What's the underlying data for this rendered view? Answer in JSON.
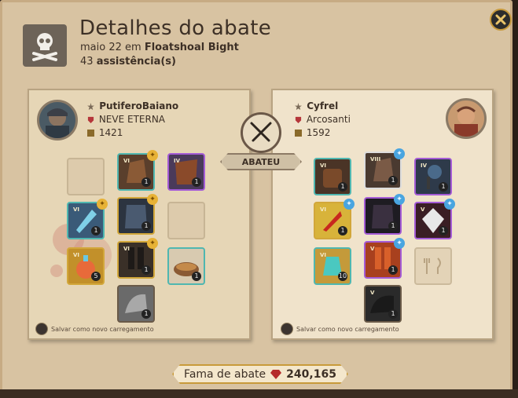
{
  "header": {
    "title": "Detalhes do abate",
    "date": "maio 22 em",
    "location": "Floatshoal Bight",
    "assist_count": "43",
    "assist_label": "assistência(s)"
  },
  "killer": {
    "name": "PutiferoBaiano",
    "guild": "NEVE ETERNA",
    "ip": "1421",
    "save_label": "Salvar como novo carregamento",
    "slots": [
      {
        "name": "bag-slot",
        "qty": "",
        "tier": "",
        "empty": true
      },
      {
        "name": "head-slot",
        "qty": "1",
        "tier": "VI",
        "empty": false
      },
      {
        "name": "cape-slot",
        "qty": "1",
        "tier": "IV",
        "empty": false
      },
      {
        "name": "mainhand-slot",
        "qty": "1",
        "tier": "VI",
        "empty": false
      },
      {
        "name": "armor-slot",
        "qty": "1",
        "tier": "",
        "empty": false
      },
      {
        "name": "offhand-slot",
        "qty": "",
        "tier": "",
        "empty": true
      },
      {
        "name": "potion-slot",
        "qty": "5",
        "tier": "VI",
        "empty": false
      },
      {
        "name": "shoes-slot",
        "qty": "1",
        "tier": "VI",
        "empty": false
      },
      {
        "name": "food-slot",
        "qty": "1",
        "tier": "",
        "empty": false
      },
      {
        "name": "mount-slot",
        "qty": "1",
        "tier": "",
        "empty": false
      }
    ]
  },
  "victim": {
    "name": "Cyfrel",
    "guild": "Arcosanti",
    "ip": "1592",
    "save_label": "Salvar como novo carregamento",
    "slots": [
      {
        "name": "bag-slot",
        "qty": "1",
        "tier": "VI",
        "empty": false
      },
      {
        "name": "head-slot",
        "qty": "1",
        "tier": "VIII",
        "empty": false
      },
      {
        "name": "cape-slot",
        "qty": "1",
        "tier": "IV",
        "empty": false
      },
      {
        "name": "mainhand-slot",
        "qty": "1",
        "tier": "VI",
        "empty": false
      },
      {
        "name": "armor-slot",
        "qty": "1",
        "tier": "",
        "empty": false
      },
      {
        "name": "offhand-slot",
        "qty": "1",
        "tier": "V",
        "empty": false
      },
      {
        "name": "potion-slot",
        "qty": "10",
        "tier": "VI",
        "empty": false
      },
      {
        "name": "shoes-slot",
        "qty": "1",
        "tier": "V",
        "empty": false
      },
      {
        "name": "food-slot",
        "qty": "",
        "tier": "",
        "empty": true
      },
      {
        "name": "mount-slot",
        "qty": "1",
        "tier": "V",
        "empty": false
      }
    ]
  },
  "center": {
    "abateu_label": "ABATEU"
  },
  "fame": {
    "label": "Fama de abate",
    "value": "240,165"
  },
  "colors": {
    "parchment": "#e8d9bd",
    "ink": "#3d3026",
    "gold": "#c89a3a",
    "blue": "#49a5e0",
    "purple": "#a45bd6"
  }
}
